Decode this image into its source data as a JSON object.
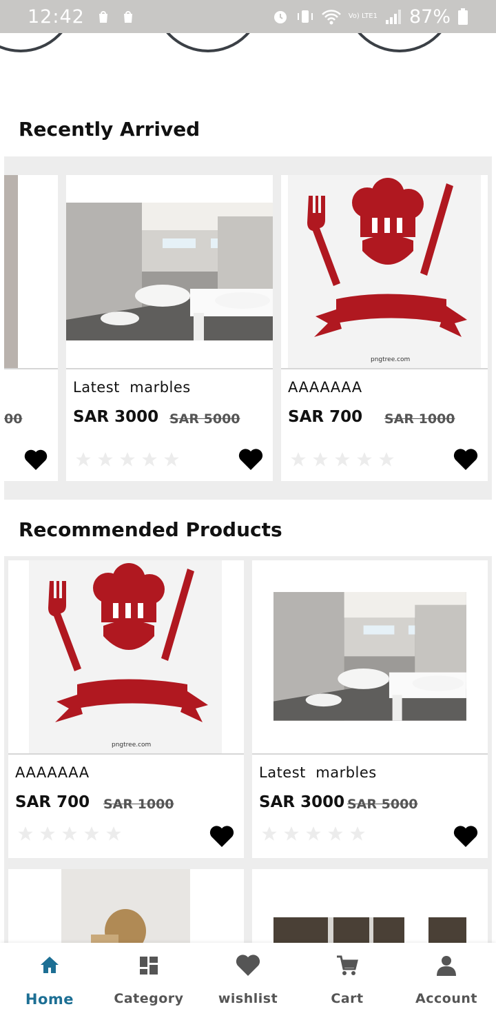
{
  "status": {
    "time": "12:42",
    "battery": "87%",
    "lte": "Vo) LTE1"
  },
  "sections": {
    "recent_title": "Recently Arrived",
    "recommended_title": "Recommended Products"
  },
  "recent": {
    "partial_card": {
      "old_price": "00"
    },
    "cards": [
      {
        "name": "Latest  marbles",
        "price": "SAR 3000",
        "old_price": "SAR 5000",
        "rating": 0,
        "image": "bathroom"
      },
      {
        "name": "AAAAAAA",
        "price": "SAR 700",
        "old_price": "SAR 1000",
        "rating": 0,
        "image": "chef-logo"
      }
    ]
  },
  "recommended": {
    "cards": [
      {
        "name": "AAAAAAA",
        "price": "SAR 700",
        "old_price": "SAR 1000",
        "rating": 0,
        "image": "chef-logo"
      },
      {
        "name": "Latest  marbles",
        "price": "SAR 3000",
        "old_price": "SAR 5000",
        "rating": 0,
        "image": "bathroom"
      }
    ]
  },
  "image_text": {
    "watermark": "pngtree.com"
  },
  "nav": {
    "items": [
      {
        "label": "Home",
        "icon": "home-icon",
        "active": true
      },
      {
        "label": "Category",
        "icon": "category-icon",
        "active": false
      },
      {
        "label": "wishlist",
        "icon": "heart-icon",
        "active": false
      },
      {
        "label": "Cart",
        "icon": "cart-icon",
        "active": false
      },
      {
        "label": "Account",
        "icon": "account-icon",
        "active": false
      }
    ]
  },
  "colors": {
    "accent": "#1d6f94",
    "nav_icon": "#555555",
    "chef_red": "#b01820",
    "status_bar": "#c8c7c5"
  }
}
